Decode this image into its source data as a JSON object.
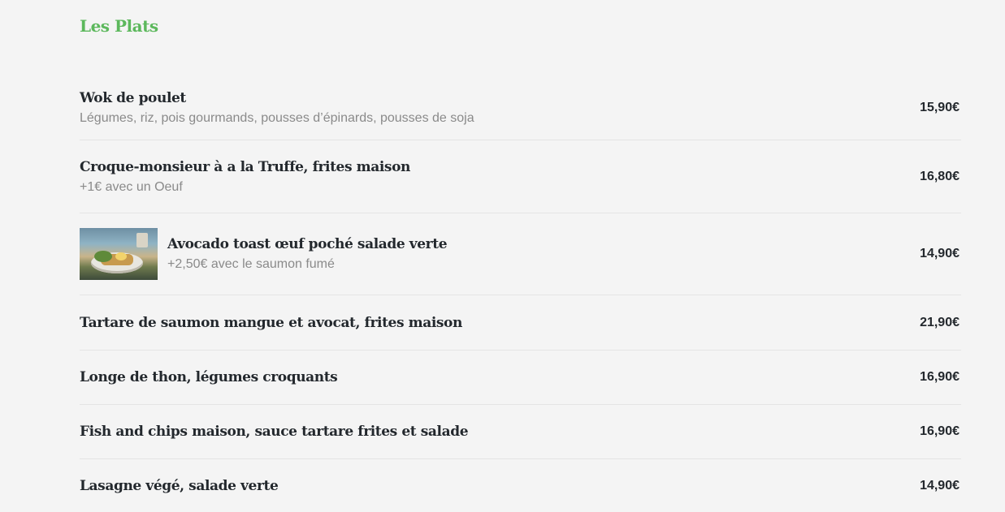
{
  "section": {
    "title": "Les Plats"
  },
  "items": [
    {
      "name": "Wok de poulet",
      "description": "Légumes, riz, pois gourmands, pousses d’épinards, pousses de soja",
      "price": "15,90€"
    },
    {
      "name": "Croque-monsieur à a la Truffe, frites maison",
      "description": "+1€ avec un Oeuf",
      "price": "16,80€"
    },
    {
      "name": "Avocado toast œuf poché salade verte",
      "description": "+2,50€ avec le saumon fumé",
      "price": "14,90€",
      "image": "avocado-toast-photo"
    },
    {
      "name": "Tartare de saumon mangue et avocat, frites maison",
      "price": "21,90€"
    },
    {
      "name": "Longe de thon, légumes croquants",
      "price": "16,90€"
    },
    {
      "name": "Fish and chips maison, sauce tartare frites et salade",
      "price": "16,90€"
    },
    {
      "name": "Lasagne végé, salade verte",
      "price": "14,90€"
    }
  ],
  "colors": {
    "accent": "#5cb85c",
    "text": "#23282d",
    "muted": "#8a8a8a",
    "background": "#f4f4f4"
  }
}
